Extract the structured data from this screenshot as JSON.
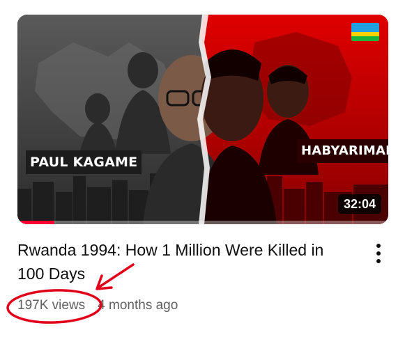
{
  "video": {
    "thumbnail": {
      "left_caption": "PAUL KAGAME",
      "right_caption": "HABYARIMANA",
      "duration": "32:04",
      "watched_fraction": 0.1,
      "flag_icon": "rwanda-flag-icon",
      "colors": {
        "left_panel": "#4a4a4a",
        "right_panel": "#d40000",
        "progress": "#ff0033"
      }
    },
    "title": "Rwanda 1994: How 1 Million Were Killed in 100 Days",
    "views": "197K views",
    "published": "4 months ago",
    "menu_icon": "more-vert-icon"
  },
  "annotation": {
    "color": "#e0001a",
    "marks": [
      "red-circle-around-views",
      "red-arrow-pointing-to-views"
    ]
  }
}
